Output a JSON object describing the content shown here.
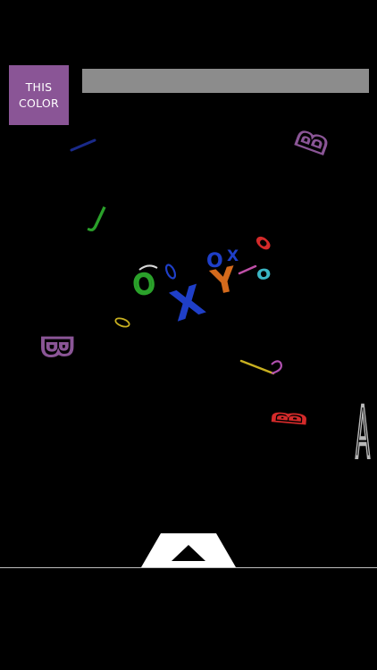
{
  "target": {
    "label_line1": "THIS",
    "label_line2": "COLOR",
    "color": "#8a5596"
  },
  "timer": {
    "fraction_remaining": 1.0,
    "fill_color": "#8c8c8c"
  },
  "letters": [
    {
      "char": "B",
      "color": "#8a5596"
    },
    {
      "char": "J",
      "color": "#2aa12a"
    },
    {
      "char": "O",
      "color": "#2aa12a"
    },
    {
      "char": "X",
      "color": "#1f3fc8"
    },
    {
      "char": "O",
      "color": "#1f3fc8"
    },
    {
      "char": "X",
      "color": "#1f3fc8"
    },
    {
      "char": "Y",
      "color": "#d46a1c"
    },
    {
      "char": "O",
      "color": "#3bb6c4"
    },
    {
      "char": "O",
      "color": "#d42a2a"
    },
    {
      "char": "B",
      "color": "#8a5596"
    },
    {
      "char": "B",
      "color": "#d42a2a"
    },
    {
      "char": "A",
      "color": "#b8b8b8"
    }
  ],
  "launcher": {
    "color": "#ffffff",
    "icon": "up-triangle-icon"
  },
  "colors": {
    "background": "#000000",
    "ground_line": "#bdbdbd"
  }
}
